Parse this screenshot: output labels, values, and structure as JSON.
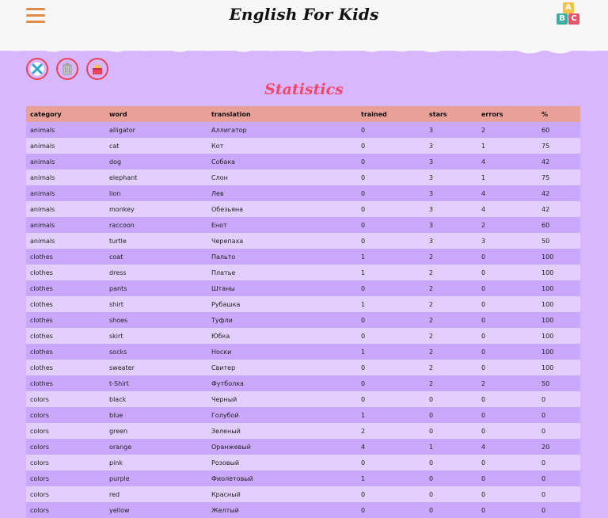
{
  "header": {
    "title": "English For Kids",
    "logo_letters": [
      "A",
      "B",
      "C"
    ]
  },
  "toolbar": {
    "buttons": [
      {
        "name": "close",
        "icon": "close-icon"
      },
      {
        "name": "trash",
        "icon": "trash-icon"
      },
      {
        "name": "train",
        "icon": "box-icon"
      }
    ]
  },
  "page": {
    "title": "Statistics"
  },
  "table": {
    "columns": [
      "category",
      "word",
      "translation",
      "trained",
      "stars",
      "errors",
      "%"
    ],
    "rows": [
      [
        "animals",
        "alligator",
        "Аллигатор",
        "0",
        "3",
        "2",
        "60"
      ],
      [
        "animals",
        "cat",
        "Кот",
        "0",
        "3",
        "1",
        "75"
      ],
      [
        "animals",
        "dog",
        "Собака",
        "0",
        "3",
        "4",
        "42"
      ],
      [
        "animals",
        "elephant",
        "Слон",
        "0",
        "3",
        "1",
        "75"
      ],
      [
        "animals",
        "lion",
        "Лев",
        "0",
        "3",
        "4",
        "42"
      ],
      [
        "animals",
        "monkey",
        "Обезьяна",
        "0",
        "3",
        "4",
        "42"
      ],
      [
        "animals",
        "raccoon",
        "Енот",
        "0",
        "3",
        "2",
        "60"
      ],
      [
        "animals",
        "turtle",
        "Черепаха",
        "0",
        "3",
        "3",
        "50"
      ],
      [
        "clothes",
        "coat",
        "Пальто",
        "1",
        "2",
        "0",
        "100"
      ],
      [
        "clothes",
        "dress",
        "Платье",
        "1",
        "2",
        "0",
        "100"
      ],
      [
        "clothes",
        "pants",
        "Штаны",
        "0",
        "2",
        "0",
        "100"
      ],
      [
        "clothes",
        "shirt",
        "Рубашка",
        "1",
        "2",
        "0",
        "100"
      ],
      [
        "clothes",
        "shoes",
        "Туфли",
        "0",
        "2",
        "0",
        "100"
      ],
      [
        "clothes",
        "skirt",
        "Юбка",
        "0",
        "2",
        "0",
        "100"
      ],
      [
        "clothes",
        "socks",
        "Носки",
        "1",
        "2",
        "0",
        "100"
      ],
      [
        "clothes",
        "sweater",
        "Свитер",
        "0",
        "2",
        "0",
        "100"
      ],
      [
        "clothes",
        "t-Shirt",
        "Футболка",
        "0",
        "2",
        "2",
        "50"
      ],
      [
        "colors",
        "black",
        "Черный",
        "0",
        "0",
        "0",
        "0"
      ],
      [
        "colors",
        "blue",
        "Голубой",
        "1",
        "0",
        "0",
        "0"
      ],
      [
        "colors",
        "green",
        "Зеленый",
        "2",
        "0",
        "0",
        "0"
      ],
      [
        "colors",
        "orange",
        "Оранжевый",
        "4",
        "1",
        "4",
        "20"
      ],
      [
        "colors",
        "pink",
        "Розовый",
        "0",
        "0",
        "0",
        "0"
      ],
      [
        "colors",
        "purple",
        "Фиолетовый",
        "1",
        "0",
        "0",
        "0"
      ],
      [
        "colors",
        "red",
        "Красный",
        "0",
        "0",
        "0",
        "0"
      ],
      [
        "colors",
        "yellow",
        "Желтый",
        "0",
        "0",
        "0",
        "0"
      ]
    ]
  },
  "colors": {
    "background": "#d8b7ff",
    "header_row": "#e9a096",
    "accent": "#f04a6a",
    "menu": "#e08a4a"
  }
}
